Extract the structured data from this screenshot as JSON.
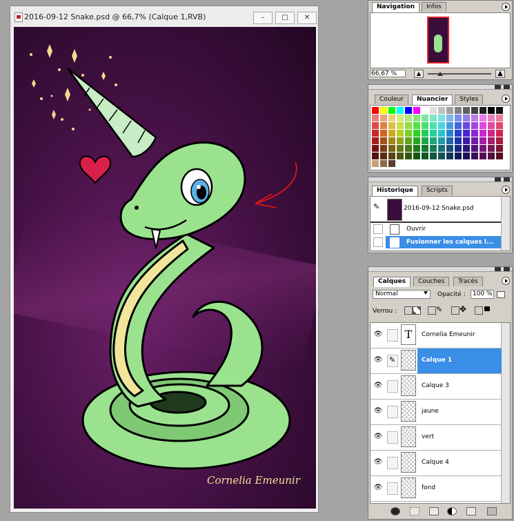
{
  "document": {
    "title": "2016-09-12 Snake.psd @ 66,7% (Calque 1,RVB)",
    "signature": "Cornelia Emeunir",
    "window_buttons": [
      "–",
      "□",
      "✕"
    ],
    "colors": {
      "bg_dark": "#2a0a2b",
      "bg_mid": "#5a1a58",
      "snake": "#9be28f",
      "belly": "#f0e59a",
      "annotation": "#d81818"
    }
  },
  "navigation": {
    "tabs": [
      "Navigation",
      "Infos"
    ],
    "zoom": "66,67 %"
  },
  "swatches": {
    "tabs": [
      "Couleur",
      "Nuancier",
      "Styles"
    ]
  },
  "history": {
    "tabs": [
      "Historique",
      "Scripts"
    ],
    "snapshot": "2016-09-12 Snake.psd",
    "steps": [
      "Ouvrir",
      "Fusionner les calques l..."
    ]
  },
  "layers": {
    "tabs": [
      "Calques",
      "Couches",
      "Tracés"
    ],
    "blend_mode": "Normal",
    "opacity_label": "Opacité :",
    "opacity_value": "100 %",
    "lock_label": "Verrou :",
    "items": [
      {
        "name": "Cornelia Emeunir",
        "type": "text",
        "selected": false
      },
      {
        "name": "Calque  1",
        "type": "pixel",
        "selected": true
      },
      {
        "name": "Calque  3",
        "type": "pixel",
        "selected": false
      },
      {
        "name": "jaune",
        "type": "pixel",
        "selected": false
      },
      {
        "name": "vert",
        "type": "pixel",
        "selected": false
      },
      {
        "name": "Calque  4",
        "type": "pixel",
        "selected": false
      },
      {
        "name": "fond",
        "type": "pixel",
        "selected": false
      }
    ]
  }
}
